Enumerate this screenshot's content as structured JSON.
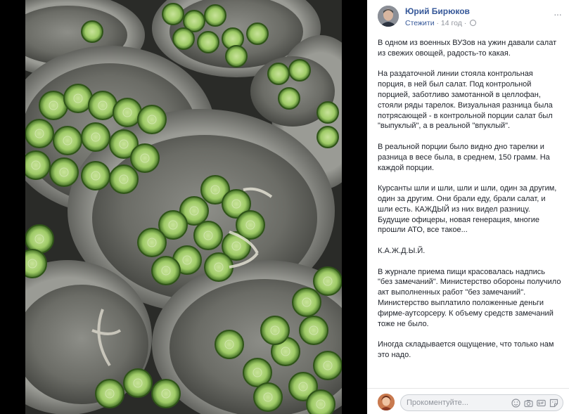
{
  "post": {
    "author": "Юрий Бирюков",
    "follow_label": "Стежити",
    "separator": "·",
    "time": "14 год",
    "more_label": "···",
    "paragraphs": [
      "В одном из военных ВУЗов на ужин давали салат из свежих овощей, радость-то какая.",
      "На раздаточной линии стояла контрольная порция, в ней был салат. Под контрольной порцией, заботливо замотанной в целлофан, стояли ряды тарелок. Визуальная разница была потрясающей - в контрольной порции салат был \"выпуклый\", а в реальной \"впуклый\".",
      "В реальной порции было видно дно тарелки и разница в весе была, в среднем, 150 грамм. На каждой порции.",
      "Курсанты шли и шли, шли и шли, один за другим, один за другим. Они брали еду, брали салат, и шли есть. КАЖДЫЙ из них видел разницу. Будущие офицеры, новая генерация, многие прошли АТО, все такое...",
      "К.А.Ж.Д.Ы.Й.",
      "В журнале приема пищи красовалась надпись \"без замечаний\". Министерство обороны получило акт выполненных работ \"без замечаний\". Министерство выплатило положенные деньги фирме-аутсорсеру. К объему средств замечаний тоже не было.",
      "Иногда складывается ощущение, что только нам это надо."
    ]
  },
  "comment_box": {
    "placeholder": "Прокоментуйте..."
  },
  "icons": {
    "globe": "globe-icon",
    "more": "more-options-icon",
    "emoji": "emoji-icon",
    "camera": "camera-icon",
    "gif": "gif-icon",
    "sticker": "sticker-icon"
  },
  "colors": {
    "link": "#365899",
    "meta": "#90949c",
    "text": "#1d2129"
  }
}
